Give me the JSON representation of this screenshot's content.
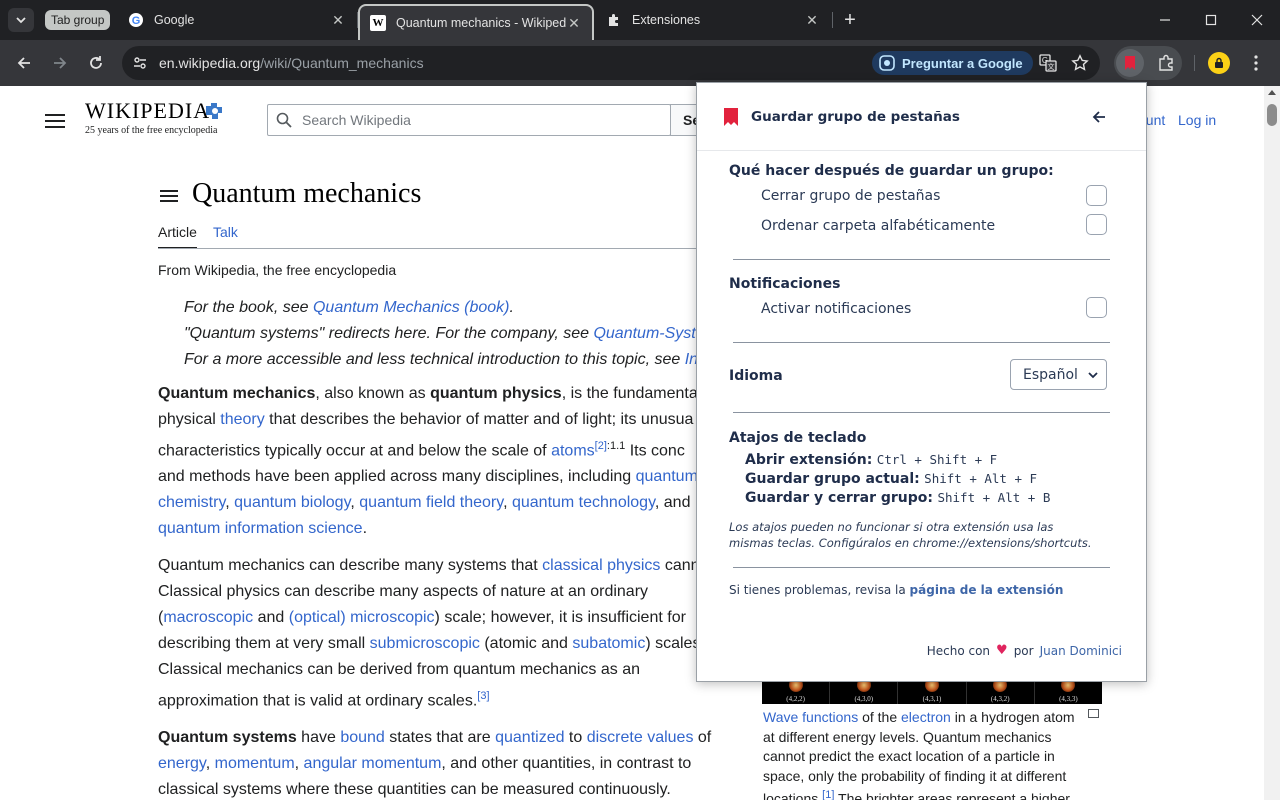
{
  "browser": {
    "tab_group_label": "Tab group",
    "tabs": [
      {
        "title": "Google",
        "favicon": "google-g-icon"
      },
      {
        "title": "Quantum mechanics - Wikipedia",
        "favicon": "wikipedia-w-icon",
        "active": true
      },
      {
        "title": "Extensiones",
        "favicon": "puzzle-icon"
      }
    ],
    "url_host": "en.wikipedia.org",
    "url_path": "/wiki/Quantum_mechanics",
    "ask_google_label": "Preguntar a Google",
    "accent_color": "#c2e7ff"
  },
  "wiki": {
    "logo_word": "WIKIPEDIA",
    "logo_tagline": "25 years of the free encyclopedia",
    "search_placeholder": "Search Wikipedia",
    "search_button": "Se",
    "account_link": "ount",
    "login_link": "Log in",
    "title": "Quantum mechanics",
    "tab_article": "Article",
    "tab_talk": "Talk",
    "from": "From Wikipedia, the free encyclopedia",
    "hatnotes": [
      {
        "pre": "For the book, see ",
        "link": "Quantum Mechanics (book)",
        "post": "."
      },
      {
        "pre": "\"Quantum systems\" redirects here. For the company, see ",
        "link": "Quantum-Syst",
        "post": ""
      },
      {
        "pre": "For a more accessible and less technical introduction to this topic, see ",
        "link": "In",
        "post": ""
      }
    ],
    "p1": {
      "l1_b1": "Quantum mechanics",
      "l1_t1": ", also known as ",
      "l1_b2": "quantum physics",
      "l1_t2": ", is the fundamenta",
      "l2_t1": "physical ",
      "l2_a1": "theory",
      "l2_t2": " that describes the behavior of matter and of light; its unusua",
      "l3_t1": "characteristics typically occur at and below the scale of ",
      "l3_a1": "atoms",
      "l3_sup": "[2]",
      "l3_sup2": ":1.1",
      "l3_t2": " Its conc",
      "l4_t1": "and methods have been applied across many disciplines, including ",
      "l4_a1": "quantum",
      "l5_a1": "chemistry",
      "l5_t1": ", ",
      "l5_a2": "quantum biology",
      "l5_t2": ", ",
      "l5_a3": "quantum field theory",
      "l5_t3": ", ",
      "l5_a4": "quantum technology",
      "l5_t4": ", and",
      "l6_a1": "quantum information science",
      "l6_t1": "."
    },
    "p2": {
      "l1_t1": "Quantum mechanics can describe many systems that ",
      "l1_a1": "classical physics",
      "l1_t2": " cann",
      "l2_t1": "Classical physics can describe many aspects of nature at an ordinary",
      "l3_t1": "(",
      "l3_a1": "macroscopic",
      "l3_t2": " and ",
      "l3_a2": "(optical) microscopic",
      "l3_t3": ") scale; however, it is insufficient for",
      "l4_t1": "describing them at very small ",
      "l4_a1": "submicroscopic",
      "l4_t2": " (atomic and ",
      "l4_a2": "subatomic",
      "l4_t3": ") scales",
      "l5_t1": "Classical mechanics can be derived from quantum mechanics as an",
      "l6_t1": "approximation that is valid at ordinary scales.",
      "l6_sup": "[3]"
    },
    "p3": {
      "l1_b1": "Quantum systems",
      "l1_t1": " have ",
      "l1_a1": "bound",
      "l1_t2": " states that are ",
      "l1_a2": "quantized",
      "l1_t3": " to ",
      "l1_a3": "discrete values",
      "l1_t4": " of",
      "l2_a1": "energy",
      "l2_t1": ", ",
      "l2_a2": "momentum",
      "l2_t2": ", ",
      "l2_a3": "angular momentum",
      "l2_t3": ", and other quantities, in contrast to",
      "l3_t1": "classical systems where these quantities can be measured continuously."
    },
    "infobox_labels": [
      "(4,2,2)",
      "(4,3,0)",
      "(4,3,1)",
      "(4,3,2)",
      "(4,3,3)"
    ],
    "caption": {
      "l1_a1": "Wave functions",
      "l1_t1": " of the ",
      "l1_a2": "electron",
      "l1_t2": " in a hydrogen atom",
      "l2_t1": "at different energy levels. Quantum mechanics",
      "l3_t1": "cannot predict the exact location of a particle in",
      "l4_t1": "space, only the probability of finding it at different",
      "l5_t1": "locations.",
      "l5_sup": "[1]",
      "l5_t2": " The brighter areas represent a higher"
    }
  },
  "popup": {
    "title": "Guardar grupo de pestañas",
    "after_save_heading": "Qué hacer después de guardar un grupo:",
    "opt_close_group": "Cerrar grupo de pestañas",
    "opt_sort_folder": "Ordenar carpeta alfabéticamente",
    "notifications_heading": "Notificaciones",
    "opt_enable_notifications": "Activar notificaciones",
    "language_heading": "Idioma",
    "language_value": "Español",
    "shortcuts_heading": "Atajos de teclado",
    "shortcuts": [
      {
        "label": "Abrir extensión:",
        "keys": "Ctrl + Shift + F"
      },
      {
        "label": "Guardar grupo actual:",
        "keys": "Shift + Alt + F"
      },
      {
        "label": "Guardar y cerrar grupo:",
        "keys": "Shift + Alt + B"
      }
    ],
    "note_line1": "Los atajos pueden no funcionar si otra extensión usa las",
    "note_line2": "mismas teclas. Configúralos en chrome://extensions/shortcuts.",
    "trouble_pre": "Si tienes problemas, revisa la ",
    "trouble_link": "página de la extensión",
    "footer_pre": "Hecho con",
    "footer_by": "por",
    "footer_author": "Juan Dominici",
    "brand_color": "#e0245e"
  }
}
